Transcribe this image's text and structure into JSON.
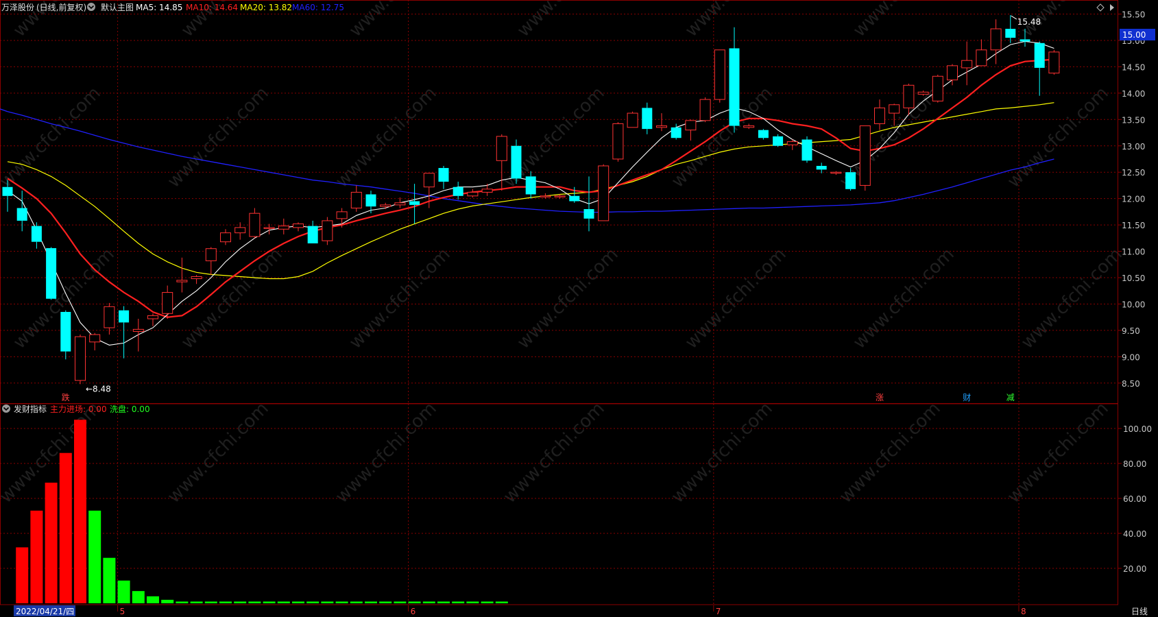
{
  "header": {
    "stock_name": "万泽股份",
    "period": "(日线,前复权)",
    "main_chart_label": "默认主图",
    "ma": [
      {
        "label": "MA5: 14.85",
        "color": "#ffffff"
      },
      {
        "label": "MA10: 14.64",
        "color": "#ff2020"
      },
      {
        "label": "MA20: 13.82",
        "color": "#ffff00"
      },
      {
        "label": "MA60: 12.75",
        "color": "#2020ff"
      }
    ]
  },
  "indicator_header": {
    "name": "发财指标",
    "main_inflow": "主力进场: 0.00",
    "washout": "洗盘: 0.00"
  },
  "annotations": {
    "low_label": "8.48",
    "high_label": "15.48",
    "current_price": "15.00",
    "markers": [
      {
        "text": "跌",
        "color": "#ff4040",
        "bar": 4
      },
      {
        "text": "涨",
        "color": "#ff4040",
        "bar": 60
      },
      {
        "text": "财",
        "color": "#20a0ff",
        "bar": 66
      },
      {
        "text": "减",
        "color": "#30ff30",
        "bar": 69
      }
    ]
  },
  "bottom_bar": {
    "date_label": "2022/04/21/四",
    "month_labels": [
      {
        "text": "5",
        "bar": 8
      },
      {
        "text": "6",
        "bar": 28
      },
      {
        "text": "7",
        "bar": 49
      },
      {
        "text": "8",
        "bar": 70
      }
    ],
    "period_button": "日线"
  },
  "watermark": "www.cfchi.com",
  "colors": {
    "up": "#ff3232",
    "down": "#00ffff",
    "ma5": "#ffffff",
    "ma10": "#ff2020",
    "ma20": "#ffff00",
    "ma60": "#2020ff",
    "grid": "#8b0000",
    "ind_red": "#ff0000",
    "ind_green": "#00ff00"
  },
  "chart_data": [
    {
      "type": "candlestick",
      "title": "万泽股份 (日线,前复权)",
      "ylim": [
        8.2,
        15.7
      ],
      "yticks": [
        8.5,
        9.0,
        9.5,
        10.0,
        10.5,
        11.0,
        11.5,
        12.0,
        12.5,
        13.0,
        13.5,
        14.0,
        14.5,
        15.0,
        15.5
      ],
      "candles": [
        [
          12.22,
          12.35,
          11.75,
          12.05
        ],
        [
          11.82,
          12.15,
          11.38,
          11.58
        ],
        [
          11.48,
          11.55,
          11.05,
          11.18
        ],
        [
          11.06,
          11.08,
          10.08,
          10.1
        ],
        [
          9.85,
          9.88,
          8.95,
          9.1
        ],
        [
          8.55,
          9.42,
          8.48,
          9.38
        ],
        [
          9.28,
          9.45,
          9.12,
          9.42
        ],
        [
          9.55,
          10.02,
          9.42,
          9.95
        ],
        [
          9.88,
          9.96,
          8.97,
          9.65
        ],
        [
          9.48,
          9.72,
          9.1,
          9.52
        ],
        [
          9.72,
          9.82,
          9.58,
          9.78
        ],
        [
          9.82,
          10.35,
          9.72,
          10.22
        ],
        [
          10.42,
          10.88,
          10.22,
          10.45
        ],
        [
          10.48,
          10.55,
          10.38,
          10.52
        ],
        [
          10.82,
          11.08,
          10.55,
          11.05
        ],
        [
          11.18,
          11.42,
          11.12,
          11.35
        ],
        [
          11.35,
          11.55,
          11.22,
          11.45
        ],
        [
          11.28,
          11.82,
          11.25,
          11.72
        ],
        [
          11.45,
          11.52,
          11.32,
          11.45
        ],
        [
          11.42,
          11.62,
          11.32,
          11.48
        ],
        [
          11.45,
          11.55,
          11.38,
          11.52
        ],
        [
          11.48,
          11.58,
          11.18,
          11.15
        ],
        [
          11.2,
          11.65,
          11.12,
          11.58
        ],
        [
          11.62,
          11.82,
          11.45,
          11.75
        ],
        [
          11.82,
          12.25,
          11.75,
          12.12
        ],
        [
          12.08,
          12.15,
          11.72,
          11.85
        ],
        [
          11.85,
          11.92,
          11.8,
          11.88
        ],
        [
          11.88,
          12.02,
          11.82,
          11.92
        ],
        [
          11.95,
          12.28,
          11.52,
          11.88
        ],
        [
          12.22,
          12.48,
          11.82,
          12.48
        ],
        [
          12.58,
          12.62,
          12.18,
          12.32
        ],
        [
          12.22,
          12.32,
          11.98,
          12.05
        ],
        [
          12.05,
          12.18,
          12.02,
          12.12
        ],
        [
          12.12,
          12.28,
          12.05,
          12.18
        ],
        [
          12.72,
          13.22,
          12.15,
          13.18
        ],
        [
          13.0,
          13.12,
          12.28,
          12.38
        ],
        [
          12.42,
          12.52,
          12.0,
          12.08
        ],
        [
          12.05,
          12.1,
          12.0,
          12.05
        ],
        [
          12.05,
          12.08,
          12.0,
          12.05
        ],
        [
          12.05,
          12.22,
          11.92,
          11.95
        ],
        [
          11.8,
          12.42,
          11.38,
          11.62
        ],
        [
          11.58,
          12.65,
          11.58,
          12.62
        ],
        [
          12.75,
          13.45,
          12.7,
          13.42
        ],
        [
          13.35,
          13.65,
          13.35,
          13.62
        ],
        [
          13.72,
          13.82,
          13.22,
          13.32
        ],
        [
          13.35,
          13.62,
          13.28,
          13.38
        ],
        [
          13.35,
          13.42,
          13.12,
          13.15
        ],
        [
          13.3,
          13.5,
          13.1,
          13.48
        ],
        [
          13.48,
          13.92,
          13.45,
          13.88
        ],
        [
          13.88,
          14.62,
          13.82,
          14.82
        ],
        [
          14.85,
          15.25,
          13.25,
          13.38
        ],
        [
          13.35,
          13.42,
          13.32,
          13.38
        ],
        [
          13.3,
          13.32,
          13.12,
          13.15
        ],
        [
          13.18,
          13.22,
          12.98,
          13.0
        ],
        [
          13.02,
          13.12,
          12.92,
          13.08
        ],
        [
          13.12,
          13.18,
          12.68,
          12.72
        ],
        [
          12.62,
          12.68,
          12.48,
          12.55
        ],
        [
          12.48,
          12.52,
          12.45,
          12.5
        ],
        [
          12.5,
          12.58,
          12.15,
          12.18
        ],
        [
          12.25,
          13.38,
          12.15,
          13.38
        ],
        [
          13.42,
          13.88,
          13.3,
          13.72
        ],
        [
          13.62,
          13.8,
          13.38,
          13.78
        ],
        [
          13.72,
          14.18,
          13.58,
          14.15
        ],
        [
          13.98,
          14.05,
          13.95,
          14.02
        ],
        [
          13.85,
          14.35,
          13.82,
          14.32
        ],
        [
          14.25,
          14.55,
          14.15,
          14.52
        ],
        [
          14.48,
          14.98,
          14.15,
          14.62
        ],
        [
          14.52,
          15.02,
          14.52,
          14.82
        ],
        [
          14.82,
          15.4,
          14.55,
          15.22
        ],
        [
          15.22,
          15.48,
          14.95,
          15.05
        ],
        [
          15.02,
          15.22,
          14.88,
          14.98
        ],
        [
          14.95,
          14.98,
          13.95,
          14.48
        ],
        [
          14.38,
          14.82,
          14.35,
          14.78
        ]
      ],
      "ma5": [
        12.15,
        11.95,
        11.4,
        10.8,
        10.2,
        9.65,
        9.35,
        9.22,
        9.26,
        9.42,
        9.55,
        9.8,
        10.05,
        10.25,
        10.5,
        10.8,
        11.05,
        11.25,
        11.4,
        11.45,
        11.48,
        11.45,
        11.48,
        11.52,
        11.68,
        11.78,
        11.82,
        11.92,
        11.98,
        12.05,
        12.15,
        12.22,
        12.22,
        12.25,
        12.35,
        12.4,
        12.35,
        12.3,
        12.18,
        12.0,
        11.9,
        12.0,
        12.3,
        12.6,
        12.88,
        13.15,
        13.35,
        13.45,
        13.48,
        13.62,
        13.72,
        13.65,
        13.52,
        13.3,
        13.12,
        12.98,
        12.85,
        12.72,
        12.6,
        12.72,
        12.95,
        13.25,
        13.6,
        13.85,
        14.05,
        14.25,
        14.4,
        14.55,
        14.75,
        14.92,
        14.98,
        14.95,
        14.85
      ],
      "ma10": [
        12.38,
        12.2,
        12.0,
        11.72,
        11.35,
        10.95,
        10.65,
        10.42,
        10.22,
        10.05,
        9.85,
        9.75,
        9.78,
        9.95,
        10.18,
        10.42,
        10.62,
        10.82,
        11.0,
        11.15,
        11.28,
        11.38,
        11.45,
        11.5,
        11.58,
        11.65,
        11.72,
        11.78,
        11.85,
        11.95,
        12.02,
        12.08,
        12.12,
        12.15,
        12.18,
        12.22,
        12.22,
        12.22,
        12.22,
        12.15,
        12.12,
        12.15,
        12.25,
        12.35,
        12.45,
        12.55,
        12.72,
        12.9,
        13.08,
        13.28,
        13.45,
        13.52,
        13.52,
        13.48,
        13.42,
        13.38,
        13.32,
        13.15,
        12.95,
        12.9,
        12.95,
        13.02,
        13.15,
        13.32,
        13.52,
        13.72,
        13.92,
        14.15,
        14.35,
        14.52,
        14.6,
        14.62,
        14.64
      ],
      "ma20": [
        12.7,
        12.65,
        12.55,
        12.42,
        12.25,
        12.05,
        11.85,
        11.62,
        11.38,
        11.15,
        10.95,
        10.8,
        10.68,
        10.6,
        10.56,
        10.54,
        10.52,
        10.5,
        10.48,
        10.48,
        10.52,
        10.62,
        10.78,
        10.92,
        11.05,
        11.18,
        11.3,
        11.42,
        11.52,
        11.62,
        11.72,
        11.8,
        11.86,
        11.9,
        11.94,
        11.98,
        12.02,
        12.05,
        12.08,
        12.1,
        12.12,
        12.18,
        12.25,
        12.32,
        12.42,
        12.55,
        12.65,
        12.72,
        12.8,
        12.88,
        12.94,
        12.98,
        13.0,
        13.02,
        13.04,
        13.06,
        13.08,
        13.1,
        13.12,
        13.2,
        13.28,
        13.35,
        13.4,
        13.45,
        13.5,
        13.55,
        13.6,
        13.65,
        13.7,
        13.72,
        13.75,
        13.78,
        13.82
      ],
      "ma60": [
        13.65,
        13.58,
        13.5,
        13.42,
        13.35,
        13.28,
        13.2,
        13.12,
        13.05,
        12.98,
        12.92,
        12.86,
        12.8,
        12.75,
        12.7,
        12.65,
        12.6,
        12.55,
        12.5,
        12.45,
        12.4,
        12.35,
        12.32,
        12.28,
        12.25,
        12.22,
        12.18,
        12.14,
        12.1,
        12.05,
        12.0,
        11.96,
        11.92,
        11.88,
        11.85,
        11.82,
        11.8,
        11.78,
        11.76,
        11.75,
        11.74,
        11.74,
        11.75,
        11.75,
        11.76,
        11.76,
        11.77,
        11.78,
        11.79,
        11.8,
        11.81,
        11.82,
        11.82,
        11.83,
        11.84,
        11.85,
        11.86,
        11.87,
        11.88,
        11.9,
        11.92,
        11.96,
        12.02,
        12.08,
        12.15,
        12.22,
        12.3,
        12.38,
        12.46,
        12.54,
        12.6,
        12.68,
        12.75
      ]
    },
    {
      "type": "bar",
      "title": "发财指标",
      "ylim": [
        0,
        106
      ],
      "yticks": [
        20,
        40,
        60,
        80,
        100
      ],
      "red": [
        0,
        32,
        53,
        69,
        86,
        105
      ],
      "green": [
        53,
        26,
        13,
        7,
        4,
        2,
        1,
        1,
        1,
        1,
        1,
        1,
        1,
        1,
        1,
        1,
        1,
        1,
        1,
        1,
        1,
        1,
        1,
        1,
        1,
        1,
        1,
        1,
        1
      ]
    }
  ]
}
